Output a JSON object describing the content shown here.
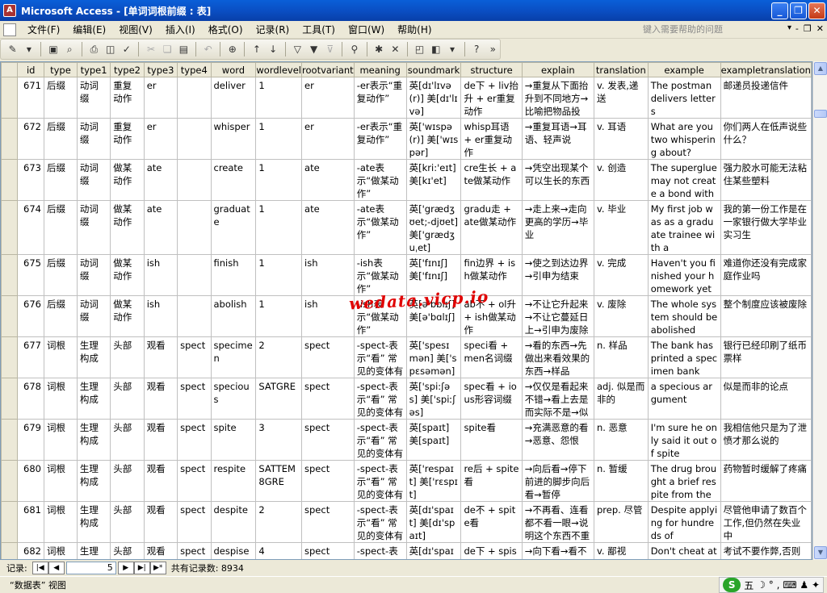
{
  "window": {
    "app_icon_letter": "A",
    "title": "Microsoft Access - [单词词根前缀 : 表]",
    "minimize": "_",
    "restore": "❐",
    "close": "✕"
  },
  "menu": {
    "items": [
      "文件(F)",
      "编辑(E)",
      "视图(V)",
      "插入(I)",
      "格式(O)",
      "记录(R)",
      "工具(T)",
      "窗口(W)",
      "帮助(H)"
    ],
    "help_placeholder": "键入需要帮助的问题",
    "doc_min": "-",
    "doc_restore": "❐",
    "doc_close": "✕"
  },
  "grid": {
    "columns": [
      "id",
      "type",
      "type1",
      "type2",
      "type3",
      "type4",
      "word",
      "wordlevel",
      "rootvariant",
      "meaning",
      "soundmark",
      "structure",
      "explain",
      "translation",
      "example",
      "exampletranslation"
    ],
    "rows": [
      [
        "671",
        "后缀",
        "动词缀",
        "重复动作",
        "er",
        "",
        "deliver",
        "1",
        "er",
        "-er表示“重复动作”",
        "英[dɪ'lɪvə(r)] 美[dɪ'lɪvə]",
        "de下 + liv抬升 + er重复动作",
        "→重复从下面抬升到不同地方→比喻把物品投",
        "v. 发表,递送",
        "The postman delivers letters",
        "邮递员投递信件"
      ],
      [
        "672",
        "后缀",
        "动词缀",
        "重复动作",
        "er",
        "",
        "whisper",
        "1",
        "er",
        "-er表示“重复动作”",
        "英['wɪspə(r)] 美['wɪspər]",
        "whisp耳语 + er重复动作",
        "→重复耳语→耳语、轻声说",
        "v. 耳语",
        "What are you two whispering about?",
        "你们两人在低声说些什么？"
      ],
      [
        "673",
        "后缀",
        "动词缀",
        "做某动作",
        "ate",
        "",
        "create",
        "1",
        "ate",
        "-ate表示“做某动作”",
        "英[kri:'eɪt] 美[kɪ'et]",
        "cre生长 + ate做某动作",
        "→凭空出现某个可以生长的东西",
        "v. 创造",
        "The superglue may not create a bond with",
        "强力胶水可能无法粘住某些塑料"
      ],
      [
        "674",
        "后缀",
        "动词缀",
        "做某动作",
        "ate",
        "",
        "graduate",
        "1",
        "ate",
        "-ate表示“做某动作”",
        "英['grædʒʊet;-djʊet] 美['grædʒuˌet]",
        "gradu走 + ate做某动作",
        "→走上来→走向更高的学历→毕业",
        "v. 毕业",
        "My first job was as a graduate trainee with a",
        "我的第一份工作是在一家银行做大学毕业实习生"
      ],
      [
        "675",
        "后缀",
        "动词缀",
        "做某动作",
        "ish",
        "",
        "finish",
        "1",
        "ish",
        "-ish表示“做某动作”",
        "英['fɪnɪʃ] 美['fɪnɪʃ]",
        "fin边界 + ish做某动作",
        "→使之到达边界→引申为结束",
        "v. 完成",
        "Haven't you finished your homework yet",
        "难道你还没有完成家庭作业吗"
      ],
      [
        "676",
        "后缀",
        "动词缀",
        "做某动作",
        "ish",
        "",
        "abolish",
        "1",
        "ish",
        "-ish表示“做某动作”",
        "英[ə'bɒlɪʃ] 美[ə'bɑlɪʃ]",
        "ab不 + ol升 + ish做某动作",
        "→不让它升起来→不让它蔓延日上→引申为废除",
        "v. 废除",
        "The whole system should be abolished",
        "整个制度应该被废除"
      ],
      [
        "677",
        "词根",
        "生理构成",
        "头部",
        "观看",
        "spect",
        "specimen",
        "2",
        "spect",
        "-spect-表示“看” 常见的变体有",
        "英['spesɪmən] 美['spɛsəmən]",
        "speci看 + men名词缀",
        "→看的东西→先做出来看效果的东西→样品",
        "n. 样品",
        "The bank has printed a specimen bank",
        "银行已经印刷了纸币票样"
      ],
      [
        "678",
        "词根",
        "生理构成",
        "头部",
        "观看",
        "spect",
        "specious",
        "SATGRE",
        "spect",
        "-spect-表示“看” 常见的变体有",
        "英['spi:ʃəs] 美['spiːʃəs]",
        "spec看 + ious形容词缀",
        "→仅仅是看起来不错→看上去是而实际不是→似",
        "adj. 似是而非的",
        "a specious argument",
        "似是而非的论点"
      ],
      [
        "679",
        "词根",
        "生理构成",
        "头部",
        "观看",
        "spect",
        "spite",
        "3",
        "spect",
        "-spect-表示“看” 常见的变体有",
        "英[spaɪt] 美[spaɪt]",
        "spite看",
        "→充满恶意的看→恶意、怨恨",
        "n. 恶意",
        "I'm sure he only said it out of spite",
        "我相信他只是为了泄愤才那么说的"
      ],
      [
        "680",
        "词根",
        "生理构成",
        "头部",
        "观看",
        "spect",
        "respite",
        "SATTEM8GRE",
        "spect",
        "-spect-表示“看” 常见的变体有",
        "英['respaɪt] 美['rɛspɪt]",
        "re后 + spite看",
        "→向后看→停下前进的脚步向后看→暂停",
        "n. 暂缓",
        "The drug brought a brief respite from the",
        "药物暂时缓解了疼痛"
      ],
      [
        "681",
        "词根",
        "生理构成",
        "头部",
        "观看",
        "spect",
        "despite",
        "2",
        "spect",
        "-spect-表示“看” 常见的变体有",
        "英[dɪ'spaɪt] 美[dɪ'spaɪt]",
        "de不 + spite看",
        "→不再看、连看都不看一眼→说明这个东西不重",
        "prep. 尽管",
        "Despite applying for hundreds of",
        "尽管他申请了数百个工作,但仍然在失业中"
      ],
      [
        "682",
        "词根",
        "生理构成",
        "头部",
        "观看",
        "spect",
        "despise",
        "4",
        "spect",
        "-spect-表示“看” 常见的变体有",
        "英[dɪ'spaɪz] 美[dɪ'spaɪz]",
        "de下 + spise看",
        "→向下看→看不起→鄙视",
        "v. 鄙视",
        "Don't cheat at examination, or your",
        "考试不要作弊,否则同班同学会轻视你的"
      ]
    ]
  },
  "navigator": {
    "label": "记录:",
    "first": "|◀",
    "prev": "◀",
    "current": "5",
    "next": "▶",
    "last": "▶|",
    "new": "▶*",
    "total_text": "共有记录数: 8934"
  },
  "status": {
    "view_text": "“数据表” 视图",
    "ime_logo": "S",
    "ime_mode": "五",
    "ime_icons": "☽ ° , ⌨ ♟ ✦"
  },
  "watermark": "wedata.vicp.io",
  "colors": {
    "title_bar": "#0a4fc4",
    "watermark": "#e00000"
  }
}
